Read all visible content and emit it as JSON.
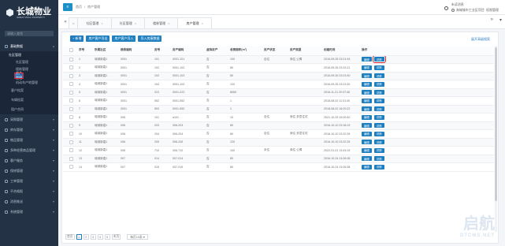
{
  "app": {
    "brand_cn": "长城物业",
    "brand_en": "GREAT WALL PROPERTY"
  },
  "sidebar": {
    "search_placeholder": "请输入查找",
    "items": [
      {
        "label": "基础数据"
      },
      {
        "label": "采购管理"
      },
      {
        "label": "库存管理"
      },
      {
        "label": "物品管理"
      },
      {
        "label": "多种经营商品管理"
      },
      {
        "label": "客户服务"
      },
      {
        "label": "保修管理"
      },
      {
        "label": "工单管理"
      },
      {
        "label": "不合格报"
      },
      {
        "label": "消息推送"
      },
      {
        "label": "系统管理"
      }
    ],
    "sub": {
      "head": "社区管理",
      "children": [
        "社区管理",
        "楼栋管理",
        "房产管理",
        "机动车产地管理"
      ],
      "extra": [
        "客户档案",
        "车辆档案",
        "租户合同"
      ]
    }
  },
  "topbar": {
    "crumbs": [
      "首页",
      "房产管理"
    ],
    "org_title": "未读消息",
    "org_name": "海城城市工业区项目",
    "user_label": "权限管理"
  },
  "tabs": [
    {
      "label": "社区管理"
    },
    {
      "label": "社区管理"
    },
    {
      "label": "楼栋管理"
    },
    {
      "label": "房产管理"
    }
  ],
  "toolbar": {
    "buttons": [
      "+ 新增",
      "房产客户导出",
      "房产客户导入",
      "导入房屋数据"
    ],
    "advanced": "展开高级搜索"
  },
  "table": {
    "headers": [
      "",
      "序号",
      "所属社区",
      "楼栋编码",
      "房号",
      "房产编码",
      "虚拟房产",
      "收费面积(m²)",
      "房产状态",
      "房产类型",
      "创建时间",
      "操作"
    ],
    "edit_label": "编辑",
    "detail_label": "详情",
    "rows": [
      [
        "1",
        "城城新嘉1",
        "0001",
        "101",
        "0001-101",
        "否",
        "100",
        "自住",
        "商住 公寓",
        "2016-09-26 23:21:49"
      ],
      [
        "2",
        "城城新嘉1",
        "0001",
        "102",
        "0001-102",
        "否",
        "80",
        "",
        "",
        "2016-09-26 23:22:21"
      ],
      [
        "3",
        "城城新嘉1",
        "0001",
        "103",
        "0001-103",
        "否",
        "80",
        "",
        "",
        "2016-09-26 23:23:40"
      ],
      [
        "4",
        "城城新嘉1",
        "0001",
        "104",
        "0001-104",
        "否",
        "120",
        "",
        "",
        "2016-09-26 23:23:40"
      ],
      [
        "5",
        "城城新嘉1",
        "0001",
        "223",
        "0001-223",
        "否",
        "8089",
        "",
        "",
        "2016-11-21 20:37:46"
      ],
      [
        "6",
        "城城新嘉1",
        "0001",
        "552",
        "0001-552",
        "否",
        "1",
        "",
        "",
        "2018-08-02 11:31:40"
      ],
      [
        "7",
        "城城新嘉1",
        "0001",
        "553",
        "0001-553",
        "否",
        "1",
        "",
        "",
        "2018-08-02 16:20:22"
      ],
      [
        "8",
        "城城新嘉1",
        "006",
        "101",
        "a101",
        "否",
        "10",
        "自住",
        "商住 多层住宅",
        "2021-10-29 15:00:40"
      ],
      [
        "9",
        "城城新嘉1",
        "006",
        "203",
        "006-203",
        "否",
        "80",
        "",
        "",
        "2016-10-10 23:18:19"
      ],
      [
        "10",
        "城城新嘉1",
        "006",
        "204",
        "006-204",
        "否",
        "80",
        "自住",
        "商住 多层住宅",
        "2016-10-10 23:22:39"
      ],
      [
        "11",
        "城城新嘉1",
        "006",
        "205",
        "006-205",
        "否",
        "120",
        "",
        "",
        "2016-10-10 23:22:39"
      ],
      [
        "12",
        "城城新嘉1",
        "006",
        "710",
        "006-710",
        "否",
        "100",
        "未住",
        "商住 公寓",
        "2022-01-01 13:43:19"
      ],
      [
        "13",
        "城城新嘉1",
        "007",
        "014",
        "007-014",
        "否",
        "80",
        "",
        "",
        "2016-10-24 13:26:38"
      ],
      [
        "14",
        "城城新嘉1",
        "007",
        "015",
        "007-015",
        "否",
        "80",
        "",
        "",
        "2016-10-24 13:26:38"
      ]
    ]
  },
  "pager": {
    "first": "首页",
    "pages": [
      "1",
      "2",
      "3",
      "4",
      "5"
    ],
    "next": "末页",
    "page_size": "每页15条 ▾"
  },
  "watermark": {
    "cn": "启航",
    "en": "DTCMS.NET"
  },
  "colors": {
    "sidebar": "#243246",
    "accent": "#1f7bbd",
    "highlight": "#d9262b"
  }
}
